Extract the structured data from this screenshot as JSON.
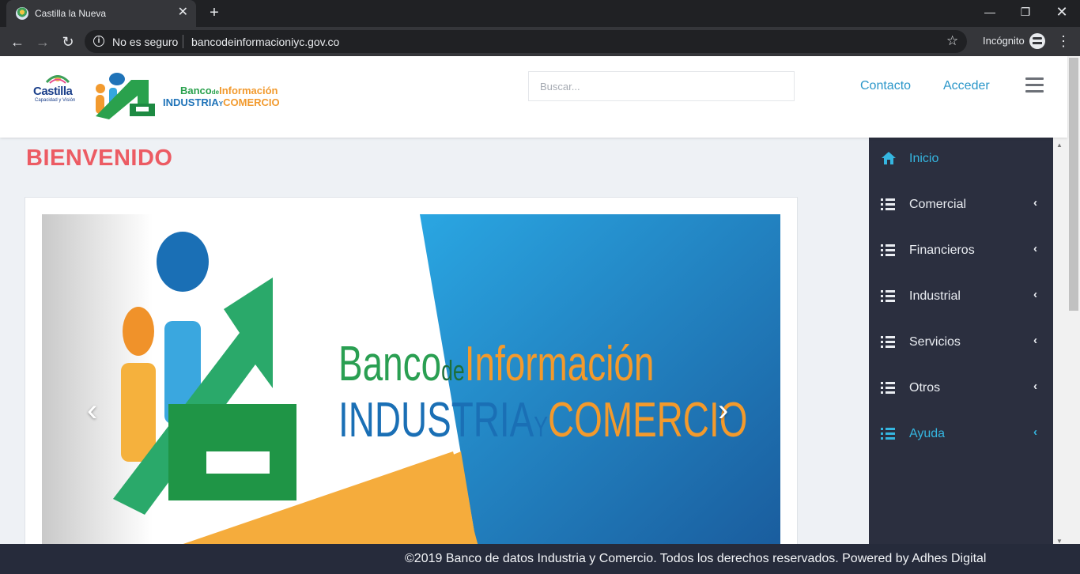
{
  "browser": {
    "tab_title": "Castilla la Nueva",
    "tab_close": "✕",
    "new_tab": "+",
    "security_label": "No es seguro",
    "url": "bancodeinformacioniyc.gov.co",
    "incognito_label": "Incógnito",
    "info_glyph": "i",
    "star_glyph": "☆",
    "kebab_glyph": "⋮",
    "back_glyph": "←",
    "forward_glyph": "→",
    "reload_glyph": "↻",
    "min_glyph": "—",
    "max_glyph": "❐",
    "close_glyph": "✕"
  },
  "header": {
    "castilla_logo": {
      "text": "Castilla",
      "subtext": "Capacidad y Visión"
    },
    "banco_logo": {
      "line1_a": "Banco",
      "line1_b": "de",
      "line1_c": "Información",
      "line2_a": "INDUSTRIA",
      "line2_b": "Y",
      "line2_c": "COMERCIO"
    },
    "search_placeholder": "Buscar...",
    "links": {
      "contacto": "Contacto",
      "acceder": "Acceder"
    }
  },
  "main": {
    "title": "BIENVENIDO",
    "carousel": {
      "slide_line1_a": "Banco",
      "slide_line1_b": "de",
      "slide_line1_c": "Información",
      "slide_line2_a": "INDUSTRIA",
      "slide_line2_b": "Y",
      "slide_line2_c": "COMERCIO",
      "prev_glyph": "‹",
      "next_glyph": "›"
    }
  },
  "sidebar": {
    "items": [
      {
        "label": "Inicio",
        "icon": "home-icon",
        "chevron": ""
      },
      {
        "label": "Comercial",
        "icon": "list-icon",
        "chevron": "‹"
      },
      {
        "label": "Financieros",
        "icon": "list-icon",
        "chevron": "‹"
      },
      {
        "label": "Industrial",
        "icon": "list-icon",
        "chevron": "‹"
      },
      {
        "label": "Servicios",
        "icon": "list-icon",
        "chevron": "‹"
      },
      {
        "label": "Otros",
        "icon": "list-icon",
        "chevron": "‹"
      },
      {
        "label": "Ayuda",
        "icon": "list-icon",
        "chevron": "‹"
      }
    ],
    "scroll_up": "▲",
    "scroll_down": "▼"
  },
  "footer": {
    "text": "©2019 Banco de datos Industria y Comercio. Todos los derechos reservados. Powered by Adhes Digital"
  },
  "colors": {
    "accent_blue": "#2a96c9",
    "title_red": "#ec5b63",
    "sidebar_bg": "#2b2f3f",
    "footer_bg": "#262b3b",
    "brand_green": "#2a9f52",
    "brand_orange": "#f39a2c",
    "brand_blue": "#1a6fb5"
  }
}
